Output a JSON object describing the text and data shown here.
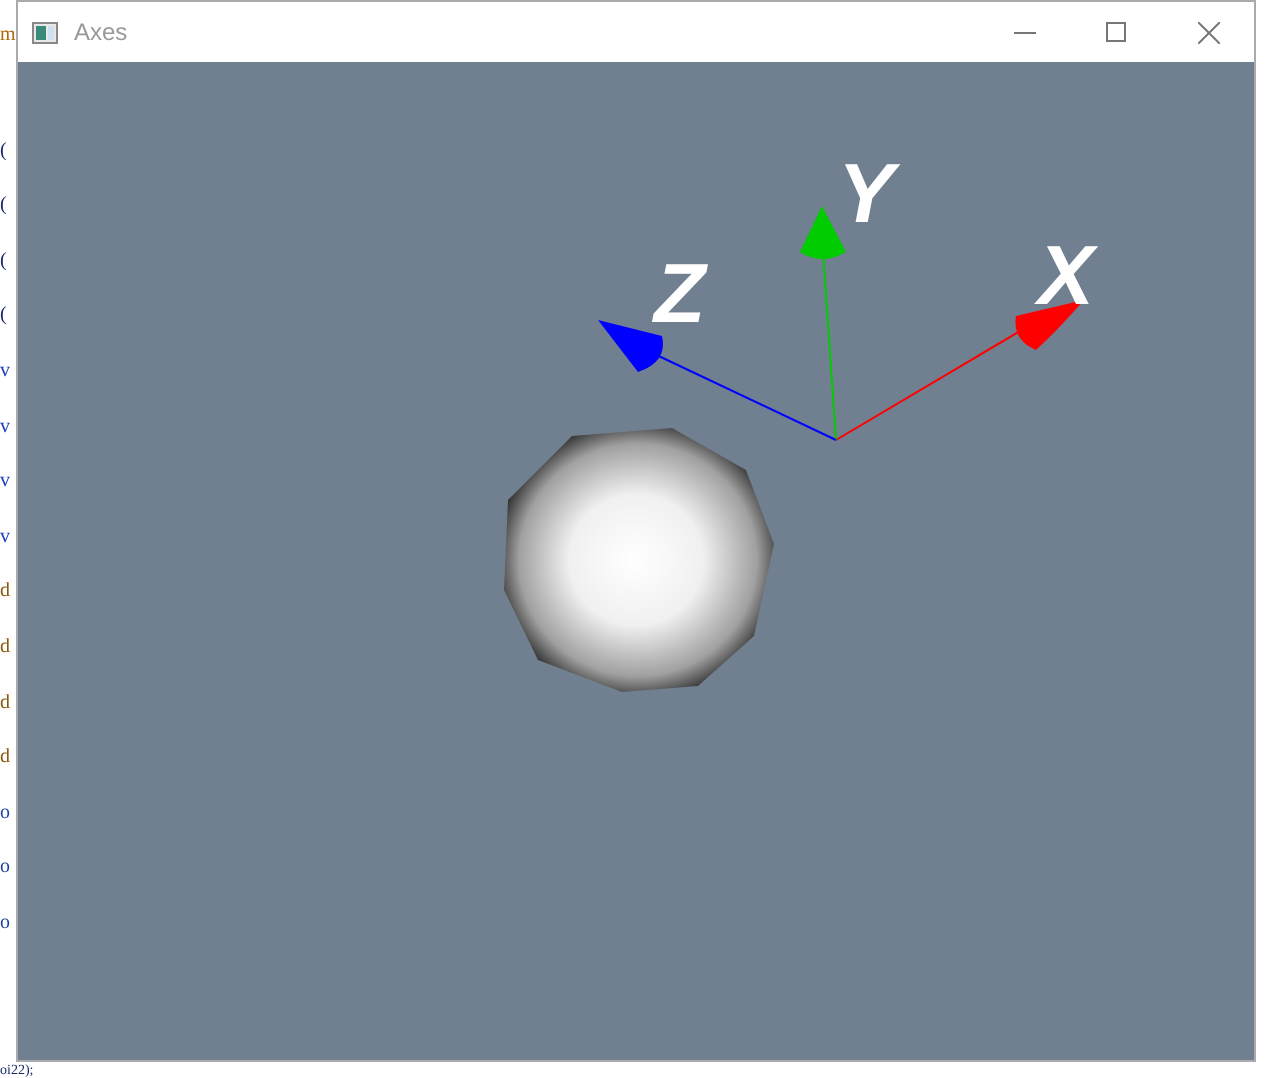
{
  "background_editor": {
    "lines": [
      {
        "text": "m",
        "color": "#b06a10"
      },
      {
        "text": "(",
        "color": "#1a2a6a"
      },
      {
        "text": "(",
        "color": "#1a2a6a"
      },
      {
        "text": "(",
        "color": "#1a2a6a"
      },
      {
        "text": "(",
        "color": "#1a2a6a"
      },
      {
        "text": "v",
        "color": "#2040c0"
      },
      {
        "text": "v",
        "color": "#2040c0"
      },
      {
        "text": "v",
        "color": "#2040c0"
      },
      {
        "text": "v",
        "color": "#2040c0"
      },
      {
        "text": "d",
        "color": "#8a5a10"
      },
      {
        "text": "d",
        "color": "#8a5a10"
      },
      {
        "text": "d",
        "color": "#8a5a10"
      },
      {
        "text": "d",
        "color": "#8a5a10"
      },
      {
        "text": "o",
        "color": "#2040a0"
      },
      {
        "text": "o",
        "color": "#2040a0"
      },
      {
        "text": "o",
        "color": "#2040a0"
      },
      {
        "text": "oi22);",
        "color": "#1a2a6a"
      }
    ]
  },
  "window": {
    "title": "Axes"
  },
  "viewport": {
    "axes": [
      {
        "label": "X",
        "color": "#ff0000"
      },
      {
        "label": "Y",
        "color": "#00cc00"
      },
      {
        "label": "Z",
        "color": "#0000ff"
      }
    ]
  }
}
